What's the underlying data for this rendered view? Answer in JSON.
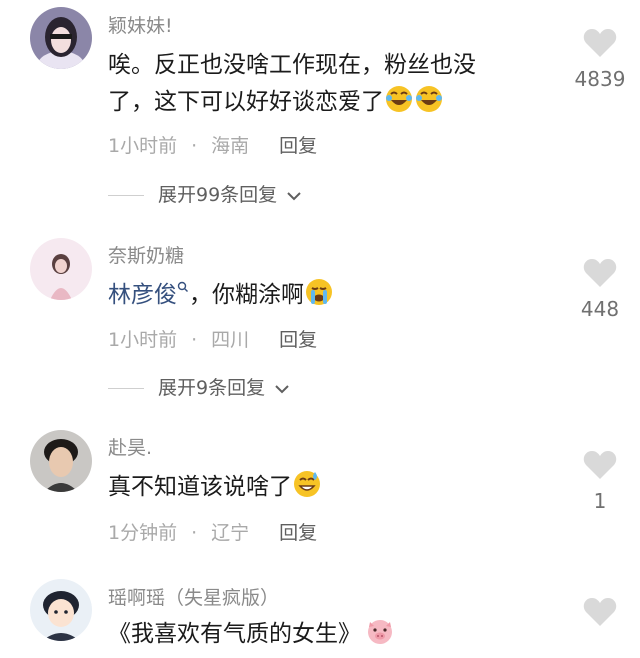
{
  "comments": [
    {
      "username": "颖妹妹!",
      "text_lines": [
        "唉。反正也没啥工作现在，粉丝也没",
        "了，这下可以好好谈恋爱了"
      ],
      "emoji": [
        "rolling-laughing-emoji",
        "rolling-laughing-emoji"
      ],
      "time": "1小时前",
      "location": "海南",
      "reply_label": "回复",
      "expand_label": "展开99条回复",
      "likes": "4839"
    },
    {
      "username": "奈斯奶糖",
      "mention": "林彦俊",
      "text": "，你糊涂啊",
      "emoji": [
        "crying-emoji"
      ],
      "time": "1小时前",
      "location": "四川",
      "reply_label": "回复",
      "expand_label": "展开9条回复",
      "likes": "448"
    },
    {
      "username": "赴昊.",
      "text": "真不知道该说啥了",
      "emoji": [
        "sweat-smile-emoji"
      ],
      "time": "1分钟前",
      "location": "辽宁",
      "reply_label": "回复",
      "likes": "1"
    },
    {
      "username": "瑶啊瑶（失星疯版）",
      "text": "《我喜欢有气质的女生》",
      "emoji": [
        "pig-emoji"
      ]
    }
  ],
  "colors": {
    "username": "#8a8a8a",
    "body": "#1b1b1b",
    "mention": "#35507e",
    "meta": "#a9a9a9",
    "heart": "#d9d9d9"
  }
}
